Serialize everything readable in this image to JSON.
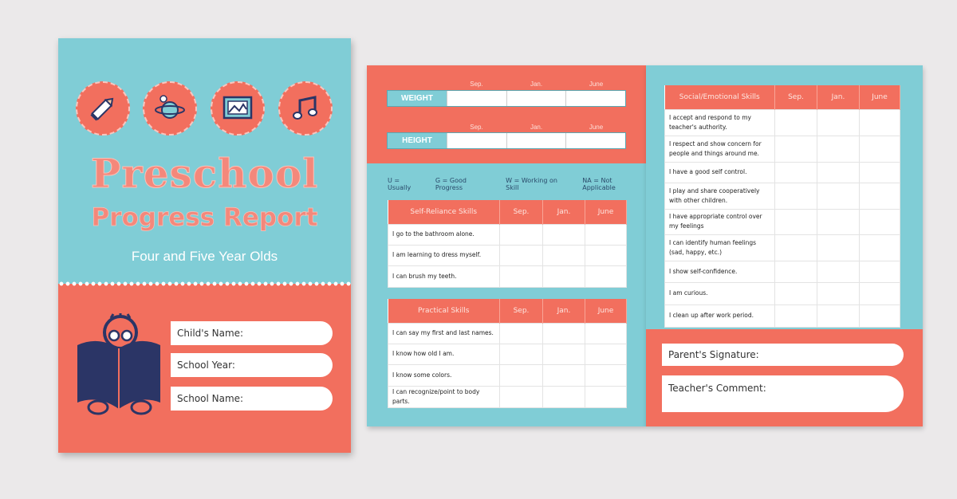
{
  "cover": {
    "icons": [
      "pencil-icon",
      "planet-icon",
      "picture-frame-icon",
      "music-note-icon"
    ],
    "title_line1": "Preschool",
    "title_line2": "Progress Report",
    "subtitle": "Four and Five Year Olds",
    "fields": [
      "Child's Name:",
      "School Year:",
      "School Name:"
    ]
  },
  "measurements": {
    "months": [
      "Sep.",
      "Jan.",
      "June"
    ],
    "weight_label": "WEIGHT",
    "height_label": "HEIGHT"
  },
  "legend": [
    "U = Usually",
    "G = Good Progress",
    "W = Working on Skill",
    "NA = Not Applicable"
  ],
  "tables": [
    {
      "title": "Self-Reliance Skills",
      "cols": [
        "Sep.",
        "Jan.",
        "June"
      ],
      "rows": [
        "I go to the bathroom alone.",
        "I am learning to dress myself.",
        "I can brush my teeth."
      ]
    },
    {
      "title": "Practical Skills",
      "cols": [
        "Sep.",
        "Jan.",
        "June"
      ],
      "rows": [
        "I can say my first and last names.",
        "I know how old I am.",
        "I know some colors.",
        "I can recognize/point to body parts."
      ]
    },
    {
      "title": "Social/Emotional Skills",
      "cols": [
        "Sep.",
        "Jan.",
        "June"
      ],
      "rows": [
        "I accept and respond to my teacher's authority.",
        "I respect and show concern for people and things around me.",
        "I have a good self control.",
        "I play and share cooperatively with other children.",
        "I have appropriate control over my feelings",
        "I can identify human feelings (sad, happy, etc.)",
        "I show self-confidence.",
        "I am curious.",
        "I clean up after work period."
      ]
    }
  ],
  "signature": {
    "parent": "Parent's Signature:",
    "teacher": "Teacher's Comment:"
  },
  "colors": {
    "coral": "#f26f5e",
    "teal": "#80cdd6",
    "navy": "#2b3566"
  }
}
